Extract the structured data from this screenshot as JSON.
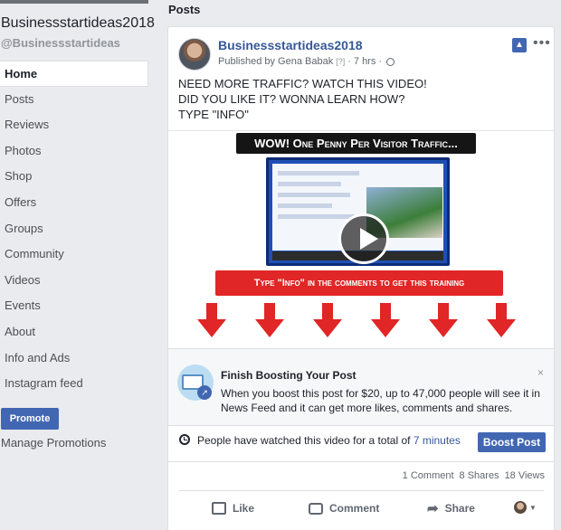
{
  "sidebar": {
    "page_name": "Businessstartideas2018",
    "handle": "@Businessstartideas",
    "nav": [
      {
        "label": "Home",
        "active": true
      },
      {
        "label": "Posts"
      },
      {
        "label": "Reviews"
      },
      {
        "label": "Photos"
      },
      {
        "label": "Shop"
      },
      {
        "label": "Offers"
      },
      {
        "label": "Groups"
      },
      {
        "label": "Community"
      },
      {
        "label": "Videos"
      },
      {
        "label": "Events"
      },
      {
        "label": "About"
      },
      {
        "label": "Info and Ads"
      },
      {
        "label": "Instagram feed"
      }
    ],
    "promote_label": "Promote",
    "manage_promotions_label": "Manage Promotions"
  },
  "main": {
    "heading": "Posts",
    "post": {
      "author": "Businessstartideas2018",
      "published_prefix": "Published by Gena Babak",
      "help_marker": "[?]",
      "separator": "·",
      "time": "7 hrs",
      "text_lines": [
        "NEED MORE TRAFFIC? WATCH THIS VIDEO!",
        "DID YOU LIKE IT? WONNA LEARN HOW?",
        "TYPE \"INFO\""
      ],
      "video": {
        "banner": "WOW! One Penny Per Visitor Traffic...",
        "cta": "Type \"Info\" in the comments to get this training"
      },
      "boost_notice": {
        "title": "Finish Boosting Your Post",
        "description": "When you boost this post for $20, up to 47,000 people will see it in News Feed and it can get more likes, comments and shares.",
        "close": "×"
      },
      "watch": {
        "prefix": "People have watched this video for a total of",
        "duration": "7 minutes",
        "boost_button": "Boost Post"
      },
      "stats": {
        "comments": "1 Comment",
        "shares": "8 Shares",
        "views": "18 Views"
      },
      "actions": {
        "like": "Like",
        "comment": "Comment",
        "share": "Share"
      }
    }
  },
  "colors": {
    "accent": "#4267b2",
    "link": "#365899",
    "page_bg": "#e9ebee",
    "video_red": "#e02626"
  },
  "icons": [
    "pin-icon",
    "more-icon",
    "globe-icon",
    "clock-icon",
    "like-icon",
    "comment-icon",
    "share-icon",
    "close-icon",
    "play-icon",
    "chevron-down-icon"
  ]
}
